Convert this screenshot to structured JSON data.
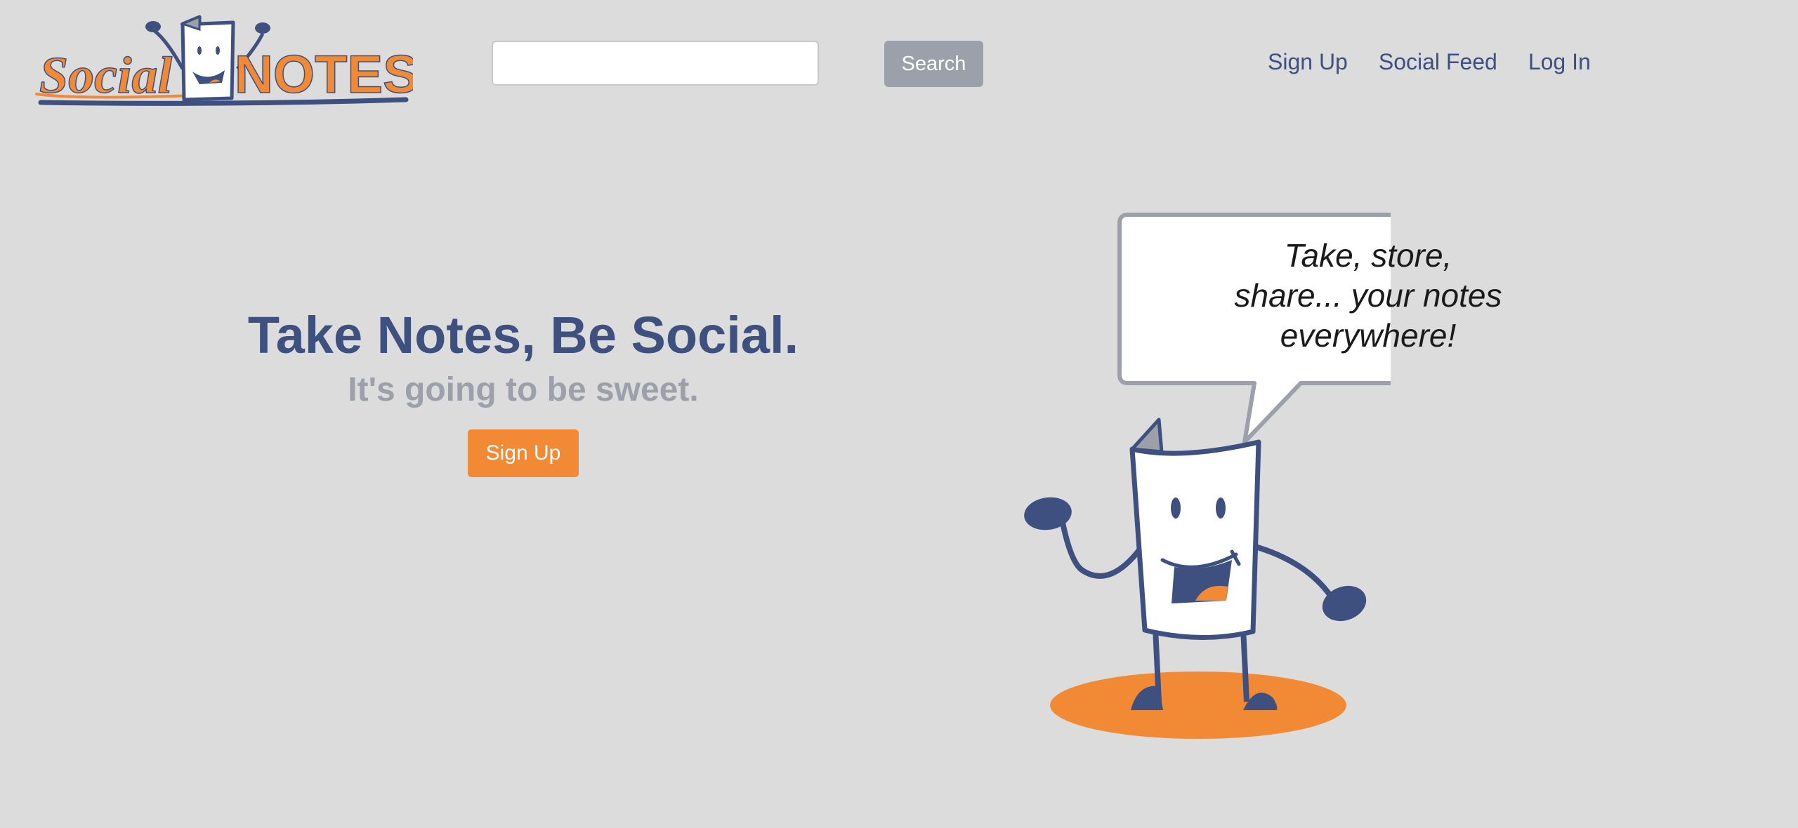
{
  "header": {
    "logo": {
      "text_part1": "Social",
      "text_part2": "NOTES"
    },
    "search": {
      "value": "",
      "placeholder": "",
      "button_label": "Search"
    },
    "nav": {
      "signup_label": "Sign Up",
      "social_feed_label": "Social Feed",
      "login_label": "Log In"
    }
  },
  "hero": {
    "title": "Take Notes, Be Social.",
    "subtitle": "It's going to be sweet.",
    "signup_label": "Sign Up"
  },
  "mascot": {
    "speech_line1": "Take, store,",
    "speech_line2": "share... your notes",
    "speech_line3": "everywhere!"
  },
  "colors": {
    "background": "#dcdcdc",
    "brand_blue": "#3d5080",
    "brand_orange": "#f28a35",
    "muted_gray": "#9ca0ab"
  }
}
